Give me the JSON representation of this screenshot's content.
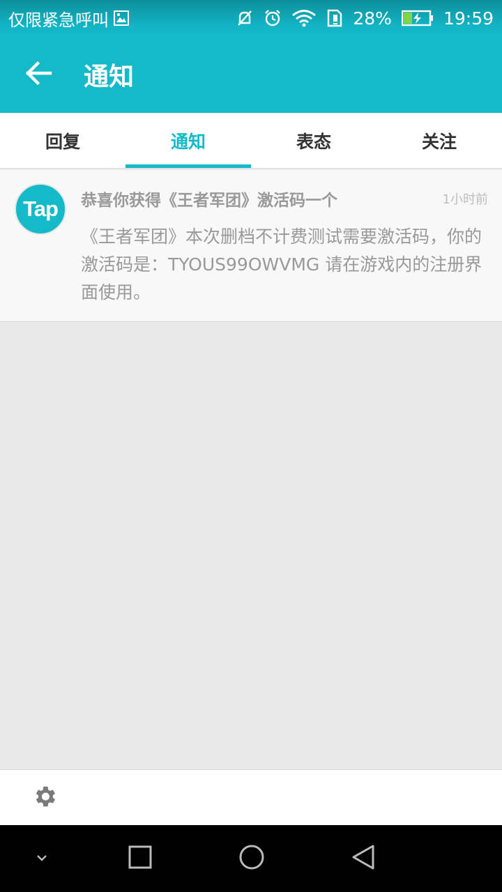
{
  "status_bar": {
    "carrier_text": "仅限紧急呼叫",
    "battery_percent": "28%",
    "time": "19:59",
    "icons": [
      "image-icon",
      "mute-icon",
      "alarm-icon",
      "wifi-icon",
      "sim-icon",
      "battery-charging-icon"
    ]
  },
  "app_bar": {
    "title": "通知",
    "back_icon": "arrow-left-icon"
  },
  "tabs": [
    {
      "label": "回复",
      "active": false
    },
    {
      "label": "通知",
      "active": true
    },
    {
      "label": "表态",
      "active": false
    },
    {
      "label": "关注",
      "active": false
    }
  ],
  "notifications": [
    {
      "avatar_text": "Tap",
      "title": "恭喜你获得《王者军团》激活码一个",
      "time": "1小时前",
      "body": "《王者军团》本次删档不计费测试需要激活码，你的激活码是：TYOUS99OWVMG 请在游戏内的注册界面使用。"
    }
  ],
  "bottom_bar": {
    "settings_icon": "gear-icon"
  },
  "nav_bar": {
    "icons": [
      "chevron-down-icon",
      "square-icon",
      "circle-icon",
      "triangle-back-icon"
    ]
  },
  "colors": {
    "accent": "#15bac9",
    "status_bar": "#13b4c4",
    "text_muted": "#999999",
    "background": "#e9e9e9"
  }
}
